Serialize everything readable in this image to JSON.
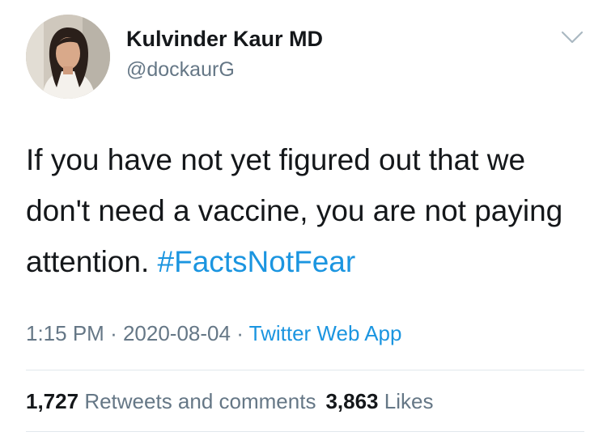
{
  "user": {
    "display_name": "Kulvinder Kaur MD",
    "handle": "@dockaurG"
  },
  "tweet": {
    "text": "If you have not yet figured out that we don't need a vaccine, you are not paying attention.",
    "hashtag": "#FactsNotFear"
  },
  "meta": {
    "time": "1:15 PM",
    "separator": "·",
    "date": "2020-08-04",
    "source": "Twitter Web App"
  },
  "stats": {
    "retweets_count": "1,727",
    "retweets_label": "Retweets and comments",
    "likes_count": "3,863",
    "likes_label": "Likes"
  },
  "colors": {
    "link": "#1b95e0",
    "secondary_text": "#657786",
    "primary_text": "#14171a"
  },
  "icons": {
    "menu": "chevron-down-icon"
  }
}
